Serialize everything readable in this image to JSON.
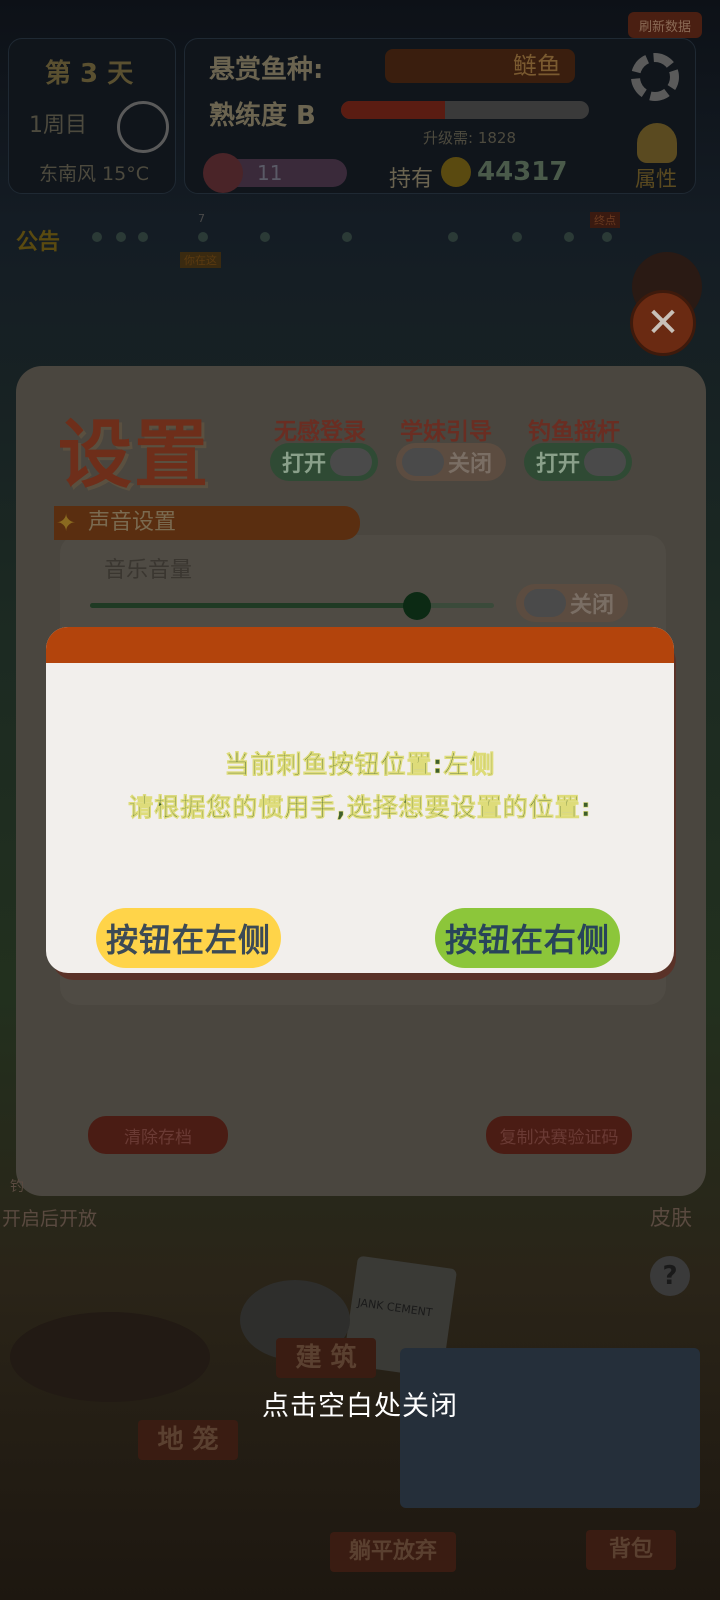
{
  "hud": {
    "refresh_label": "刷新数据",
    "day_label": "第 3 天",
    "week_label": "1周目",
    "weather": "东南风 15°C",
    "bounty_label": "悬赏鱼种:",
    "bounty_fish": "鲢鱼",
    "proficiency_label": "熟练度 B",
    "proficiency_progress": 0.42,
    "upgrade_label": "升级需: 1828",
    "energy_value": "11",
    "holding_label": "持有",
    "coins": "44317",
    "attribute_label": "属性",
    "notice_label": "公告",
    "notice_marker": "7",
    "notice_tag": "你在这",
    "notice_badge": "终点"
  },
  "settings": {
    "title": "设置",
    "toggles": [
      {
        "label": "无感登录",
        "state": "打开"
      },
      {
        "label": "学妹引导",
        "state": "关闭"
      },
      {
        "label": "钓鱼摇杆",
        "state": "打开"
      }
    ],
    "section_title": "声音设置",
    "music_label": "音乐音量",
    "music_volume": 0.81,
    "music_toggle": "关闭",
    "clear_label": "清除存档",
    "copy_label": "复制决赛验证码"
  },
  "background": {
    "left_caption_line1": "钓",
    "left_caption_line2": "开启后开放",
    "skin_label": "皮肤",
    "question_mark": "?",
    "building_label": "建 筑",
    "trap_label": "地 笼",
    "giveup_label": "躺平放弃",
    "backpack_label": "背包",
    "box_label": "JANK CEMENT"
  },
  "dialog": {
    "message_line1": "当前刺鱼按钮位置:左侧",
    "message_line2": "请根据您的惯用手,选择想要设置的位置:",
    "left_button": "按钮在左侧",
    "right_button": "按钮在右侧"
  },
  "hint": "点击空白处关闭",
  "colors": {
    "dialog_header": "#b3440c",
    "left_button": "#ffd449",
    "right_button": "#8cc63a",
    "dialog_bg": "#f2efec"
  }
}
